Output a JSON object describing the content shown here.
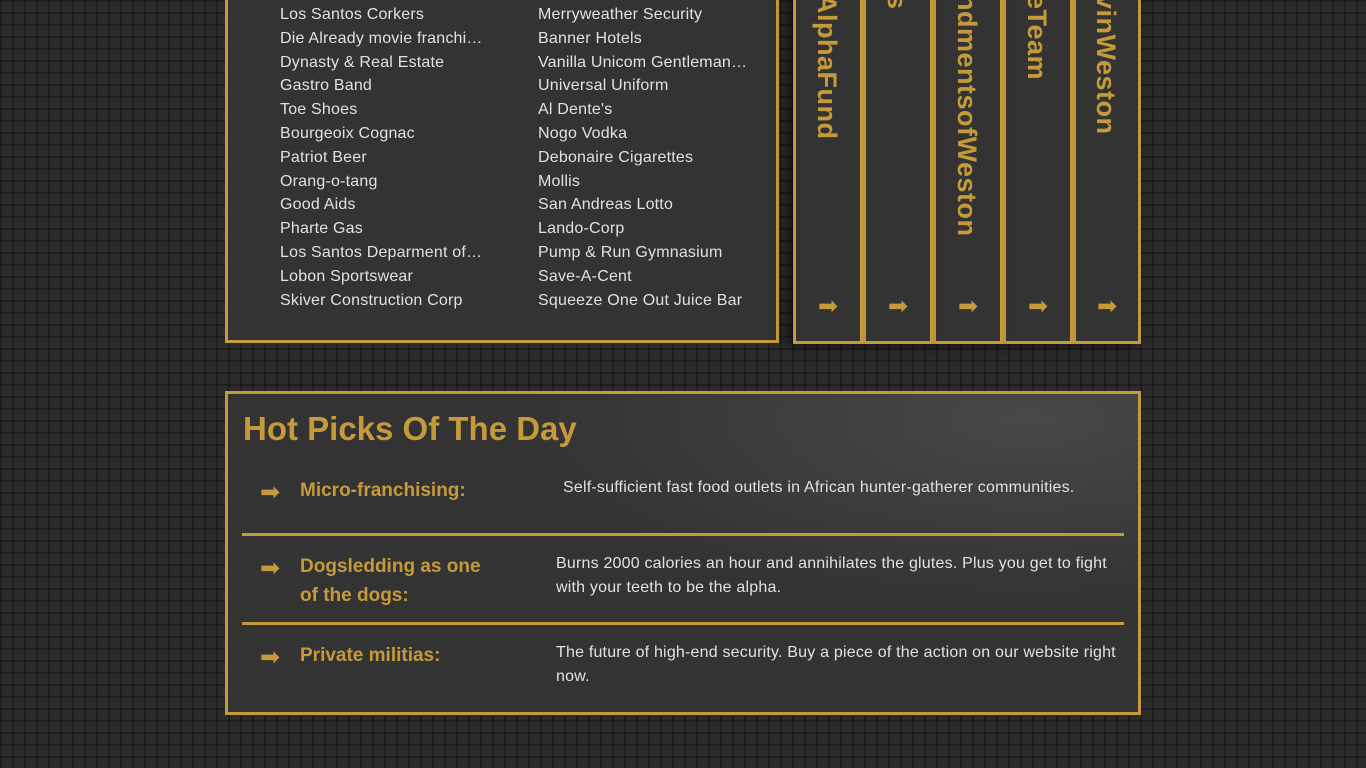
{
  "clients": {
    "left": [
      "Los Santos Corkers",
      "Die Already movie franchi…",
      "Dynasty & Real Estate",
      "Gastro Band",
      "Toe Shoes",
      "Bourgeoix Cognac",
      "Patriot Beer",
      "Orang-o-tang",
      "Good Aids",
      "Pharte Gas",
      "Los Santos Deparment of…",
      "Lobon Sportswear",
      "Skiver Construction Corp"
    ],
    "right": [
      "Merryweather Security",
      "Banner Hotels",
      "Vanilla Unicom Gentleman…",
      "Universal Uniform",
      "Al Dente's",
      "Nogo Vodka",
      "Debonaire Cigarettes",
      "Mollis",
      "San Andreas Lotto",
      "Lando-Corp",
      "Pump & Run Gymnasium",
      "Save-A-Cent",
      "Squeeze One Out Juice Bar"
    ]
  },
  "tabs": [
    {
      "label": "AlphaFund",
      "arrow": "➡"
    },
    {
      "label": "s",
      "arrow": "➡"
    },
    {
      "label": "ndmentsofWeston",
      "arrow": "➡"
    },
    {
      "label": "eTeam",
      "arrow": "➡"
    },
    {
      "label": "vinWeston",
      "arrow": "➡"
    }
  ],
  "hot_picks": {
    "title": "Hot Picks Of The Day",
    "items": [
      {
        "name": "Micro-franchising:",
        "desc": "Self-sufficient fast food outlets in African hunter-gatherer communities.",
        "arrow": "➡"
      },
      {
        "name": "Dogsledding as one of the dogs:",
        "desc": "Burns 2000 calories an hour and annihilates the glutes. Plus you get to fight with your teeth to be the alpha.",
        "arrow": "➡"
      },
      {
        "name": "Private militias:",
        "desc": "The future of high-end security. Buy a piece of the action on our website right now.",
        "arrow": "➡"
      }
    ]
  },
  "colors": {
    "accent": "#c59a3a",
    "panel": "#333333",
    "text": "#e1e1e1"
  }
}
